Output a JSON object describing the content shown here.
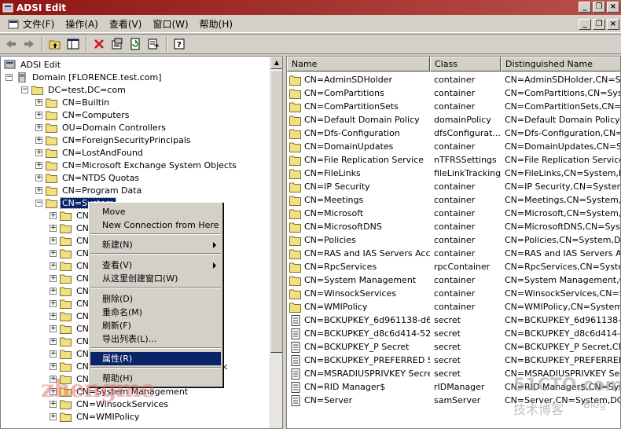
{
  "window": {
    "title": "ADSI Edit"
  },
  "menubar": {
    "items": [
      "文件(F)",
      "操作(A)",
      "查看(V)",
      "窗口(W)",
      "帮助(H)"
    ]
  },
  "toolbar": {
    "icons": [
      "back-icon",
      "forward-icon",
      "up-folder-icon",
      "show-hide-tree-icon",
      "delete-icon",
      "properties-icon",
      "refresh-icon",
      "export-list-icon",
      "help-icon"
    ]
  },
  "tree": {
    "root": "ADSI Edit",
    "domain": "Domain [FLORENCE.test.com]",
    "dc": "DC=test,DC=com",
    "children": [
      "CN=Builtin",
      "CN=Computers",
      "OU=Domain Controllers",
      "CN=ForeignSecurityPrincipals",
      "CN=LostAndFound",
      "CN=Microsoft Exchange System Objects",
      "CN=NTDS Quotas",
      "CN=Program Data"
    ],
    "selected": "CN=System",
    "sub_visible": [
      "CN=RpcServices",
      "CN=System Management",
      "CN=WinsockServices",
      "CN=WMIPolicy"
    ],
    "partial_right": "k"
  },
  "context_menu": {
    "items": [
      "Move",
      "New Connection from Here",
      "新建(N)",
      "查看(V)",
      "从这里创建窗口(W)",
      "删除(D)",
      "重命名(M)",
      "刷新(F)",
      "导出列表(L)...",
      "属性(R)",
      "帮助(H)"
    ],
    "highlighted": "属性(R)"
  },
  "list": {
    "columns": [
      "Name",
      "Class",
      "Distinguished Name"
    ],
    "rows": [
      {
        "name": "CN=AdminSDHolder",
        "class": "container",
        "dn": "CN=AdminSDHolder,CN=Syste",
        "icon": "folder"
      },
      {
        "name": "CN=ComPartitions",
        "class": "container",
        "dn": "CN=ComPartitions,CN=System",
        "icon": "folder"
      },
      {
        "name": "CN=ComPartitionSets",
        "class": "container",
        "dn": "CN=ComPartitionSets,CN=Sys",
        "icon": "folder"
      },
      {
        "name": "CN=Default Domain Policy",
        "class": "domainPolicy",
        "dn": "CN=Default Domain Policy,CN=",
        "icon": "folder"
      },
      {
        "name": "CN=Dfs-Configuration",
        "class": "dfsConfigurat...",
        "dn": "CN=Dfs-Configuration,CN=Sys",
        "icon": "folder"
      },
      {
        "name": "CN=DomainUpdates",
        "class": "container",
        "dn": "CN=DomainUpdates,CN=Syste",
        "icon": "folder"
      },
      {
        "name": "CN=File Replication Service",
        "class": "nTFRSSettings",
        "dn": "CN=File Replication Service,CN",
        "icon": "folder"
      },
      {
        "name": "CN=FileLinks",
        "class": "fileLinkTracking",
        "dn": "CN=FileLinks,CN=System,DC=",
        "icon": "folder"
      },
      {
        "name": "CN=IP Security",
        "class": "container",
        "dn": "CN=IP Security,CN=System,DC",
        "icon": "folder"
      },
      {
        "name": "CN=Meetings",
        "class": "container",
        "dn": "CN=Meetings,CN=System,DC=",
        "icon": "folder"
      },
      {
        "name": "CN=Microsoft",
        "class": "container",
        "dn": "CN=Microsoft,CN=System,DC=",
        "icon": "folder"
      },
      {
        "name": "CN=MicrosoftDNS",
        "class": "container",
        "dn": "CN=MicrosoftDNS,CN=System,",
        "icon": "folder"
      },
      {
        "name": "CN=Policies",
        "class": "container",
        "dn": "CN=Policies,CN=System,DC=te",
        "icon": "folder"
      },
      {
        "name": "CN=RAS and IAS Servers Acc...",
        "class": "container",
        "dn": "CN=RAS and IAS Servers Acce",
        "icon": "folder"
      },
      {
        "name": "CN=RpcServices",
        "class": "rpcContainer",
        "dn": "CN=RpcServices,CN=System,D",
        "icon": "folder"
      },
      {
        "name": "CN=System Management",
        "class": "container",
        "dn": "CN=System Management,CN=",
        "icon": "folder"
      },
      {
        "name": "CN=WinsockServices",
        "class": "container",
        "dn": "CN=WinsockServices,CN=Syst",
        "icon": "folder"
      },
      {
        "name": "CN=WMIPolicy",
        "class": "container",
        "dn": "CN=WMIPolicy,CN=System,DC",
        "icon": "folder"
      },
      {
        "name": "CN=BCKUPKEY_6d961138-d6...",
        "class": "secret",
        "dn": "CN=BCKUPKEY_6d961138-d64",
        "icon": "doc"
      },
      {
        "name": "CN=BCKUPKEY_d8c6d414-52...",
        "class": "secret",
        "dn": "CN=BCKUPKEY_d8c6d414-520",
        "icon": "doc"
      },
      {
        "name": "CN=BCKUPKEY_P Secret",
        "class": "secret",
        "dn": "CN=BCKUPKEY_P Secret,CN=S",
        "icon": "doc"
      },
      {
        "name": "CN=BCKUPKEY_PREFERRED S...",
        "class": "secret",
        "dn": "CN=BCKUPKEY_PREFERRED Se",
        "icon": "doc"
      },
      {
        "name": "CN=MSRADIUSPRIVKEY Secret",
        "class": "secret",
        "dn": "CN=MSRADIUSPRIVKEY Secret",
        "icon": "doc"
      },
      {
        "name": "CN=RID Manager$",
        "class": "rIDManager",
        "dn": "CN=RID Manager$,CN=Syster",
        "icon": "doc"
      },
      {
        "name": "CN=Server",
        "class": "samServer",
        "dn": "CN=Server,CN=System,DC=te",
        "icon": "doc"
      }
    ]
  },
  "watermarks": {
    "left": "zhengme",
    "right_top": "51CTO.com",
    "right_mid": "技术博客",
    "right_end": "Blog"
  }
}
